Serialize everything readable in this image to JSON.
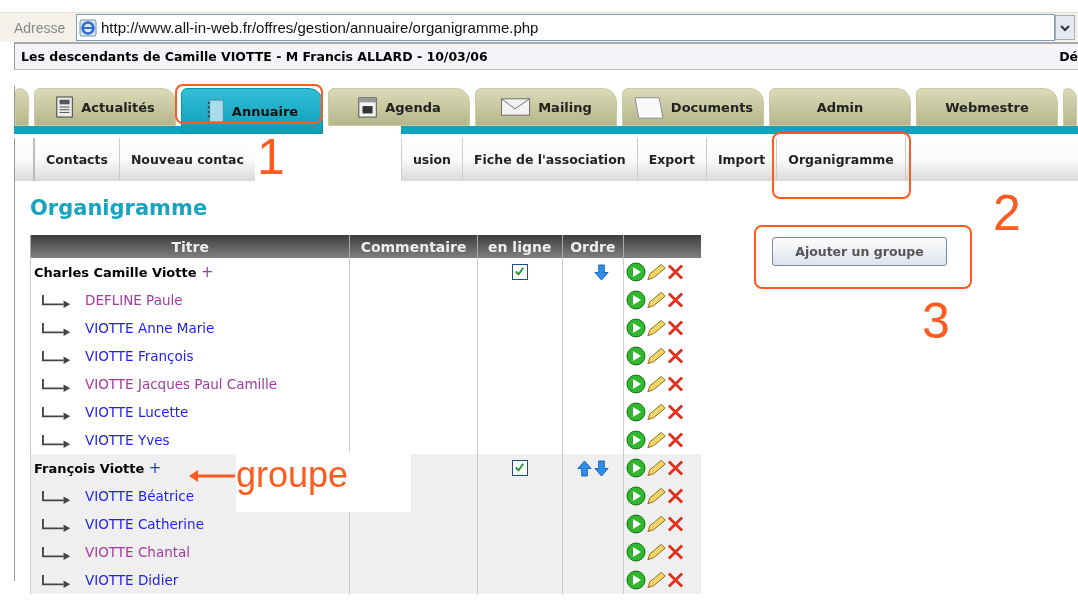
{
  "address_bar": {
    "label": "Adresse",
    "url": "http://www.all-in-web.fr/offres/gestion/annuaire/organigramme.php"
  },
  "title_bar": {
    "title": "Les descendants de Camille VIOTTE - M Francis ALLARD - 10/03/06",
    "right_text": "Dé"
  },
  "tabs": [
    {
      "selected": false,
      "highlighted": false
    },
    {
      "label": "Actualités",
      "selected": false,
      "highlighted": false
    },
    {
      "label": "Annuaire",
      "selected": true,
      "highlighted": true
    },
    {
      "label": "Agenda",
      "selected": false,
      "highlighted": false
    },
    {
      "label": "Mailing",
      "selected": false,
      "highlighted": false
    },
    {
      "label": "Documents",
      "selected": false,
      "highlighted": false
    },
    {
      "label": "Admin",
      "selected": false,
      "highlighted": false
    },
    {
      "label": "Webmestre",
      "selected": false,
      "highlighted": false
    },
    {
      "selected": false,
      "highlighted": false
    }
  ],
  "subnav": [
    {
      "label": "Contacts",
      "highlighted": false
    },
    {
      "label": "Nouveau contac",
      "highlighted": false
    },
    {
      "label": "usion",
      "highlighted": false
    },
    {
      "label": "Fiche de l'association",
      "highlighted": false
    },
    {
      "label": "Export",
      "highlighted": false
    },
    {
      "label": "Import",
      "highlighted": false
    },
    {
      "label": "Organigramme",
      "highlighted": true
    }
  ],
  "heading": "Organigramme",
  "add_group_button": {
    "label": "Ajouter un groupe",
    "highlighted": true
  },
  "table": {
    "columns": [
      "Titre",
      "Commentaire",
      "en ligne",
      "Ordre"
    ],
    "groups": [
      {
        "title": "Charles Camille Viotte",
        "add_link": {
          "text": "+",
          "visited": true
        },
        "online": true,
        "up": false,
        "down": true,
        "children": [
          {
            "name": "DEFLINE Paule",
            "visited": true
          },
          {
            "name": "VIOTTE Anne Marie",
            "visited": false
          },
          {
            "name": "VIOTTE François",
            "visited": false
          },
          {
            "name": "VIOTTE Jacques Paul Camille",
            "visited": true
          },
          {
            "name": "VIOTTE Lucette",
            "visited": false
          },
          {
            "name": "VIOTTE Yves",
            "visited": false
          }
        ]
      },
      {
        "title": "François Viotte",
        "add_link": {
          "text": "+",
          "visited": false
        },
        "online": true,
        "up": true,
        "down": true,
        "children": [
          {
            "name": "VIOTTE Béatrice",
            "visited": false
          },
          {
            "name": "VIOTTE Catherine",
            "visited": false
          },
          {
            "name": "VIOTTE Chantal",
            "visited": true
          },
          {
            "name": "VIOTTE Didier",
            "visited": false
          }
        ]
      }
    ]
  },
  "annotations": [
    {
      "kind": "number",
      "text": "1"
    },
    {
      "kind": "number",
      "text": "2"
    },
    {
      "kind": "number",
      "text": "3"
    },
    {
      "kind": "label",
      "text": "groupe"
    }
  ]
}
